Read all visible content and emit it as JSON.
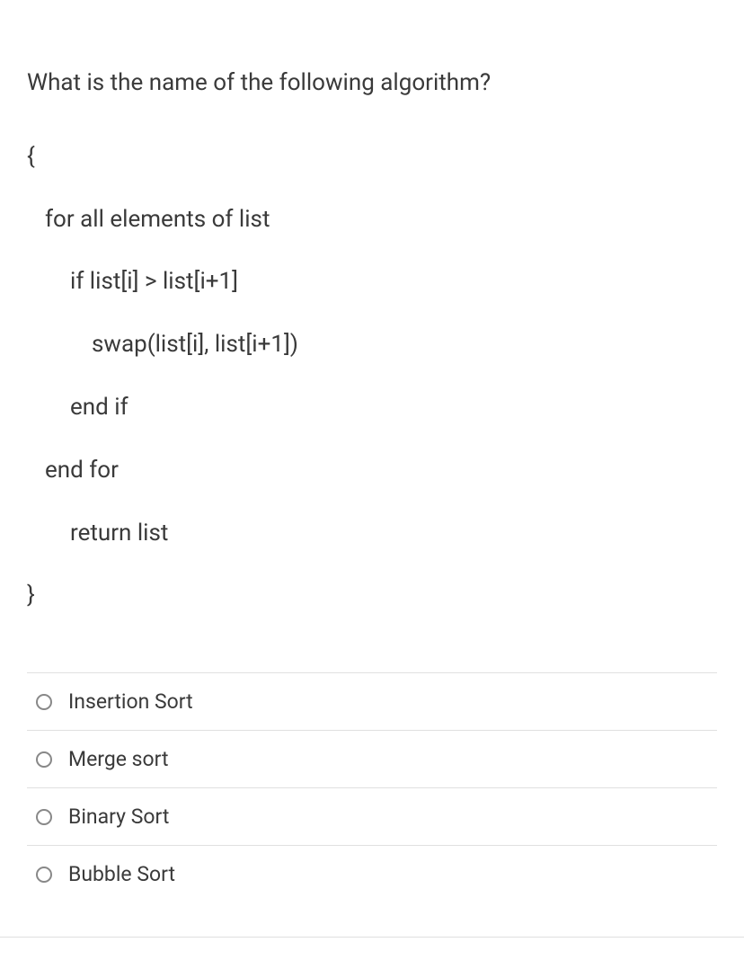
{
  "question": {
    "prompt": "What is the name of the following algorithm?",
    "code": {
      "line1": "{",
      "line2": "for all elements of list",
      "line3": "if list[i] > list[i+1]",
      "line4": "swap(list[i], list[i+1])",
      "line5": "end if",
      "line6": "end for",
      "line7": "return list",
      "line8": "}"
    }
  },
  "options": [
    {
      "label": "Insertion Sort"
    },
    {
      "label": "Merge sort"
    },
    {
      "label": "Binary Sort"
    },
    {
      "label": "Bubble Sort"
    }
  ]
}
